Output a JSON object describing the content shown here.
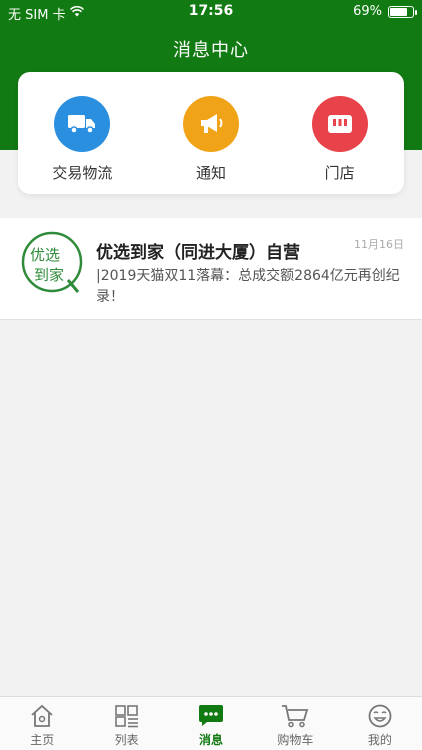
{
  "status_bar": {
    "carrier": "无 SIM 卡",
    "time": "17:56",
    "battery": "69%",
    "battery_level": 0.69
  },
  "header": {
    "title": "消息中心"
  },
  "categories": [
    {
      "label": "交易物流",
      "icon": "truck-icon",
      "color": "#2b8fe0"
    },
    {
      "label": "通知",
      "icon": "megaphone-icon",
      "color": "#f0a316"
    },
    {
      "label": "门店",
      "icon": "store-icon",
      "color": "#e8424a"
    }
  ],
  "messages": [
    {
      "title": "优选到家（同进大厦）自营",
      "date": "11月16日",
      "body": "|2019天猫双11落幕：总成交额2864亿元再创纪录！",
      "logo_text_1": "优选",
      "logo_text_2": "到家"
    }
  ],
  "tab_bar": {
    "tabs": [
      {
        "label": "主页",
        "icon": "home-icon",
        "active": false
      },
      {
        "label": "列表",
        "icon": "grid-list-icon",
        "active": false
      },
      {
        "label": "消息",
        "icon": "chat-bubble-icon",
        "active": true
      },
      {
        "label": "购物车",
        "icon": "cart-icon",
        "active": false
      },
      {
        "label": "我的",
        "icon": "smiley-icon",
        "active": false
      }
    ]
  },
  "colors": {
    "header_green": "#127a12",
    "accent": "#127a12"
  }
}
